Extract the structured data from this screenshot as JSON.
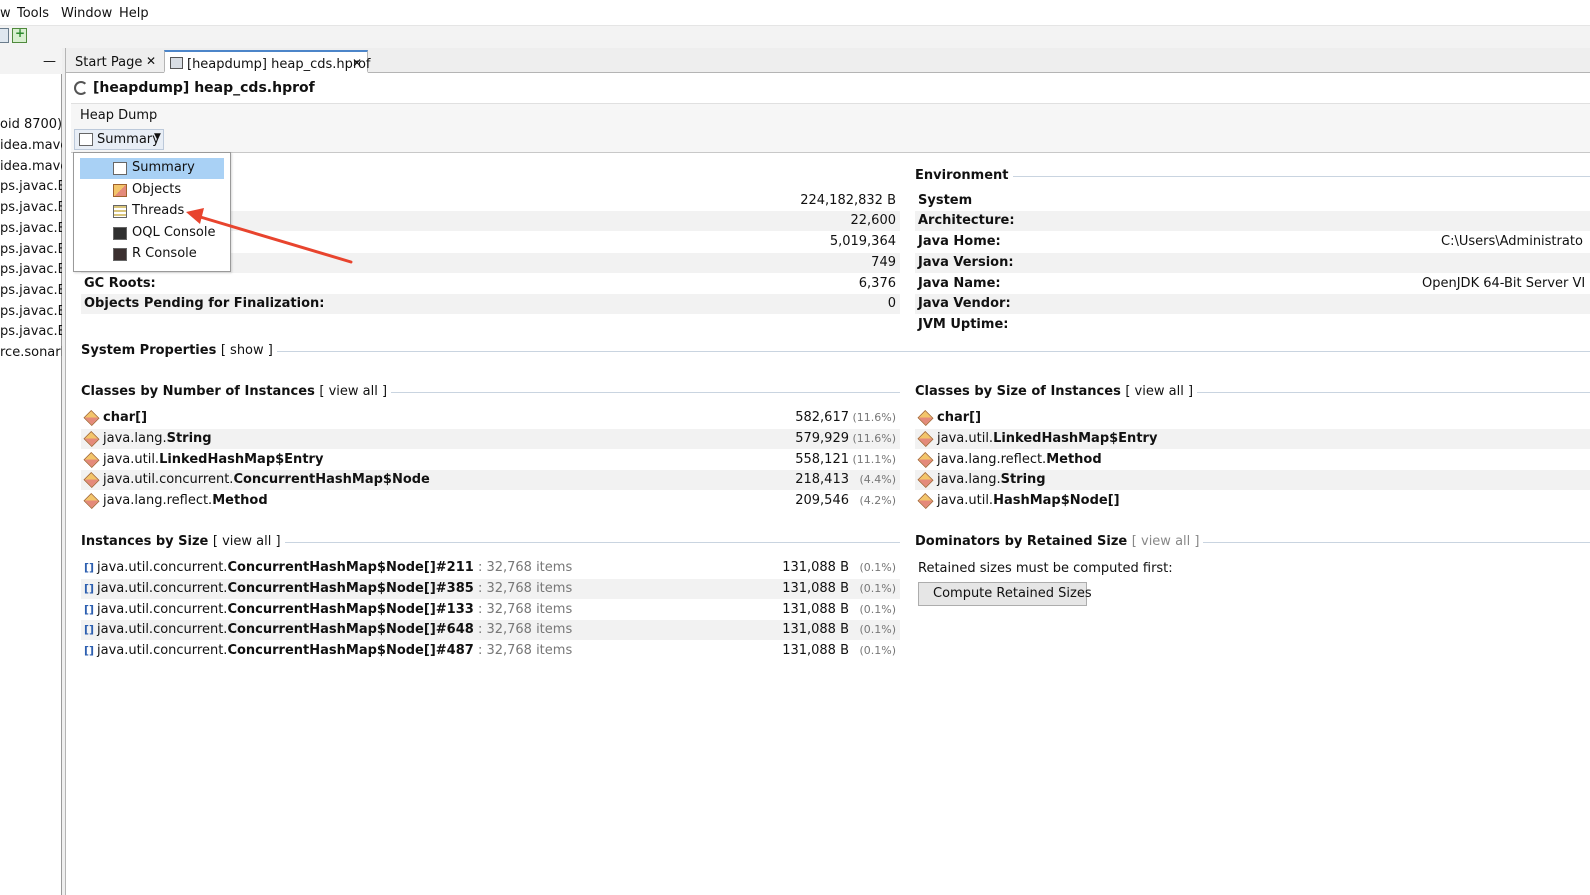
{
  "menubar": {
    "items": [
      "w",
      "Tools",
      "Window",
      "Help"
    ]
  },
  "left_tree": {
    "minimize": "—",
    "items": [
      "oid 8700)",
      "idea.maven",
      "idea.maven",
      "ps.javac.Ex",
      "ps.javac.Ex",
      "ps.javac.Ex",
      "ps.javac.Ex",
      "ps.javac.Ex",
      "ps.javac.Ex",
      "ps.javac.Ex",
      "ps.javac.Ex",
      "rce.sonarlin"
    ]
  },
  "tabs": [
    {
      "label": "Start Page",
      "close": "✕",
      "active": false
    },
    {
      "label": "[heapdump] heap_cds.hprof",
      "close": "✕",
      "active": true
    }
  ],
  "document": {
    "title": "[heapdump] heap_cds.hprof",
    "subtitle": "Heap Dump",
    "view_button": "Summary"
  },
  "view_menu": {
    "items": [
      {
        "label": "Summary",
        "icon": "summary-icon",
        "selected": true
      },
      {
        "label": "Objects",
        "icon": "objects-icon",
        "selected": false
      },
      {
        "label": "Threads",
        "icon": "threads-icon",
        "selected": false
      },
      {
        "label": "OQL Console",
        "icon": "oql-console-icon",
        "selected": false
      },
      {
        "label": "R Console",
        "icon": "r-console-icon",
        "selected": false
      }
    ]
  },
  "basic_info": {
    "rows": [
      {
        "key": "",
        "value": "224,182,832 B"
      },
      {
        "key": "",
        "value": "22,600"
      },
      {
        "key": "",
        "value": "5,019,364"
      },
      {
        "key": "",
        "value": "749"
      },
      {
        "key": "GC Roots:",
        "value": "6,376"
      },
      {
        "key": "Objects Pending for Finalization:",
        "value": "0"
      }
    ]
  },
  "environment": {
    "header": "Environment",
    "rows": [
      {
        "key": "System",
        "value": ""
      },
      {
        "key": "Architecture:",
        "value": ""
      },
      {
        "key": "Java Home:",
        "value": "C:\\Users\\Administrato"
      },
      {
        "key": "Java Version:",
        "value": ""
      },
      {
        "key": "Java Name:",
        "value": "OpenJDK 64-Bit Server VI"
      },
      {
        "key": "Java Vendor:",
        "value": ""
      },
      {
        "key": "JVM Uptime:",
        "value": ""
      }
    ]
  },
  "system_properties": {
    "header": "System Properties",
    "link": "[ show ]"
  },
  "classes_by_instances": {
    "header": "Classes by Number of Instances",
    "link": "[ view all ]",
    "rows": [
      {
        "pkg": "",
        "cls": "char[]",
        "value": "582,617",
        "pct": "(11.6%)"
      },
      {
        "pkg": "java.lang.",
        "cls": "String",
        "value": "579,929",
        "pct": "(11.6%)"
      },
      {
        "pkg": "java.util.",
        "cls": "LinkedHashMap$Entry",
        "value": "558,121",
        "pct": "(11.1%)"
      },
      {
        "pkg": "java.util.concurrent.",
        "cls": "ConcurrentHashMap$Node",
        "value": "218,413",
        "pct": "(4.4%)"
      },
      {
        "pkg": "java.lang.reflect.",
        "cls": "Method",
        "value": "209,546",
        "pct": "(4.2%)"
      }
    ]
  },
  "classes_by_size": {
    "header": "Classes by Size of Instances",
    "link": "[ view all ]",
    "rows": [
      {
        "pkg": "",
        "cls": "char[]"
      },
      {
        "pkg": "java.util.",
        "cls": "LinkedHashMap$Entry"
      },
      {
        "pkg": "java.lang.reflect.",
        "cls": "Method"
      },
      {
        "pkg": "java.lang.",
        "cls": "String"
      },
      {
        "pkg": "java.util.",
        "cls": "HashMap$Node[]"
      }
    ]
  },
  "instances_by_size": {
    "header": "Instances by Size",
    "link": "[ view all ]",
    "rows": [
      {
        "pkg": "java.util.concurrent.",
        "cls": "ConcurrentHashMap$Node[]#211",
        "items": ": 32,768 items",
        "value": "131,088 B",
        "pct": "(0.1%)"
      },
      {
        "pkg": "java.util.concurrent.",
        "cls": "ConcurrentHashMap$Node[]#385",
        "items": ": 32,768 items",
        "value": "131,088 B",
        "pct": "(0.1%)"
      },
      {
        "pkg": "java.util.concurrent.",
        "cls": "ConcurrentHashMap$Node[]#133",
        "items": ": 32,768 items",
        "value": "131,088 B",
        "pct": "(0.1%)"
      },
      {
        "pkg": "java.util.concurrent.",
        "cls": "ConcurrentHashMap$Node[]#648",
        "items": ": 32,768 items",
        "value": "131,088 B",
        "pct": "(0.1%)"
      },
      {
        "pkg": "java.util.concurrent.",
        "cls": "ConcurrentHashMap$Node[]#487",
        "items": ": 32,768 items",
        "value": "131,088 B",
        "pct": "(0.1%)"
      }
    ]
  },
  "dominators": {
    "header": "Dominators by Retained Size",
    "link": "[ view all ]",
    "note": "Retained sizes must be computed first:",
    "button": "Compute Retained Sizes"
  },
  "colors": {
    "accent": "#4c85c9",
    "selection": "#a9d1f5",
    "annotation_arrow": "#e8442e"
  }
}
